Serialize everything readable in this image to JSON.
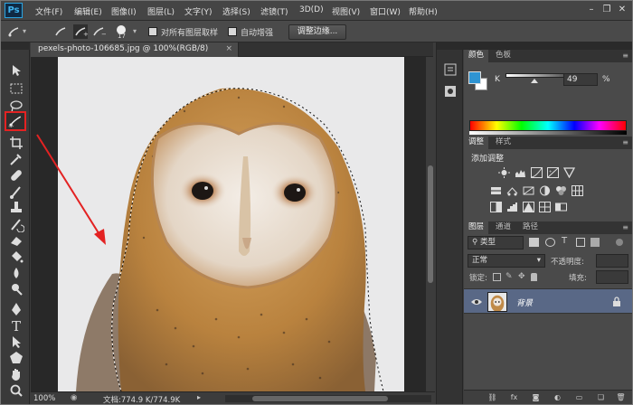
{
  "app": {
    "logo": "Ps"
  },
  "menu": [
    "文件(F)",
    "编辑(E)",
    "图像(I)",
    "图层(L)",
    "文字(Y)",
    "选择(S)",
    "滤镜(T)",
    "3D(D)",
    "视图(V)",
    "窗口(W)",
    "帮助(H)"
  ],
  "options_bar": {
    "brush_size": "17",
    "sample_all_layers_label": "对所有图层取样",
    "auto_enhance_label": "自动增强",
    "refine_edge_button": "调整边缘..."
  },
  "document": {
    "tab_title": "pexels-photo-106685.jpg @ 100%(RGB/8)",
    "close_glyph": "×"
  },
  "status": {
    "zoom": "100%",
    "doc_info": "文档:774.9 K/774.9K"
  },
  "color_panel": {
    "tabs": [
      "颜色",
      "色板"
    ],
    "channel": "K",
    "value": "49",
    "unit": "%",
    "foreground": "#2f94d2",
    "background": "#ffffff"
  },
  "adjustments_panel": {
    "tabs": [
      "调整",
      "样式"
    ],
    "title": "添加调整"
  },
  "layers_panel": {
    "tabs": [
      "图层",
      "通道",
      "路径"
    ],
    "filter_kind": "类型",
    "blend_mode": "正常",
    "opacity_label": "不透明度:",
    "lock_label": "锁定:",
    "fill_label": "填充:",
    "layers": [
      {
        "name": "背景",
        "locked": true,
        "visible": true
      }
    ]
  },
  "colors": {
    "accent": "#2f94d2",
    "highlight": "#e32222",
    "selected_layer": "#596886"
  }
}
